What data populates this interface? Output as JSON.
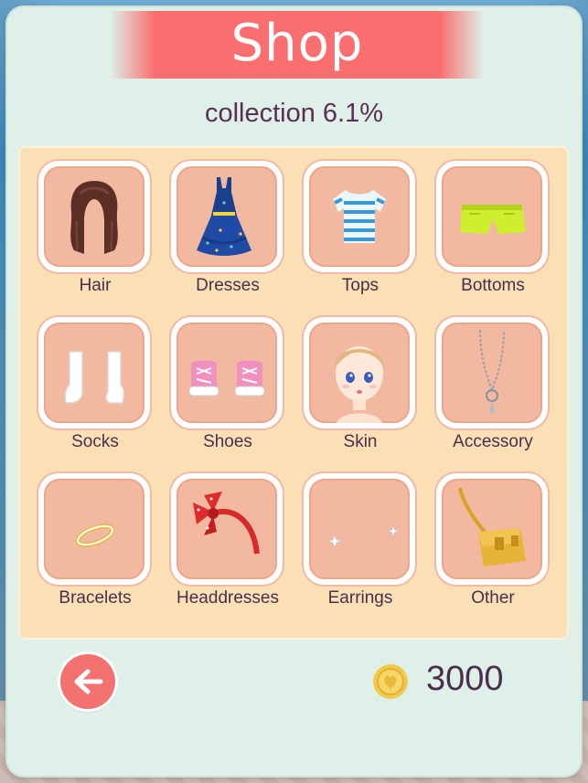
{
  "shop": {
    "title": "Shop",
    "collection_text": "collection 6.1%",
    "coins": "3000",
    "categories": [
      {
        "label": "Hair",
        "icon": "hair-icon"
      },
      {
        "label": "Dresses",
        "icon": "dress-icon"
      },
      {
        "label": "Tops",
        "icon": "top-icon"
      },
      {
        "label": "Bottoms",
        "icon": "shorts-icon"
      },
      {
        "label": "Socks",
        "icon": "socks-icon"
      },
      {
        "label": "Shoes",
        "icon": "sneakers-icon"
      },
      {
        "label": "Skin",
        "icon": "face-icon"
      },
      {
        "label": "Accessory",
        "icon": "necklace-icon"
      },
      {
        "label": "Bracelets",
        "icon": "bracelet-icon"
      },
      {
        "label": "Headdresses",
        "icon": "headband-icon"
      },
      {
        "label": "Earrings",
        "icon": "earrings-icon"
      },
      {
        "label": "Other",
        "icon": "handbag-icon"
      }
    ]
  },
  "colors": {
    "banner": "#f96f6f",
    "panel": "#dff0e9",
    "grid_panel": "#fbe0b6",
    "tile": "#f2b8a0",
    "text": "#4a2e4c",
    "back_button": "#f3726f",
    "coin": "#f2c94c"
  }
}
